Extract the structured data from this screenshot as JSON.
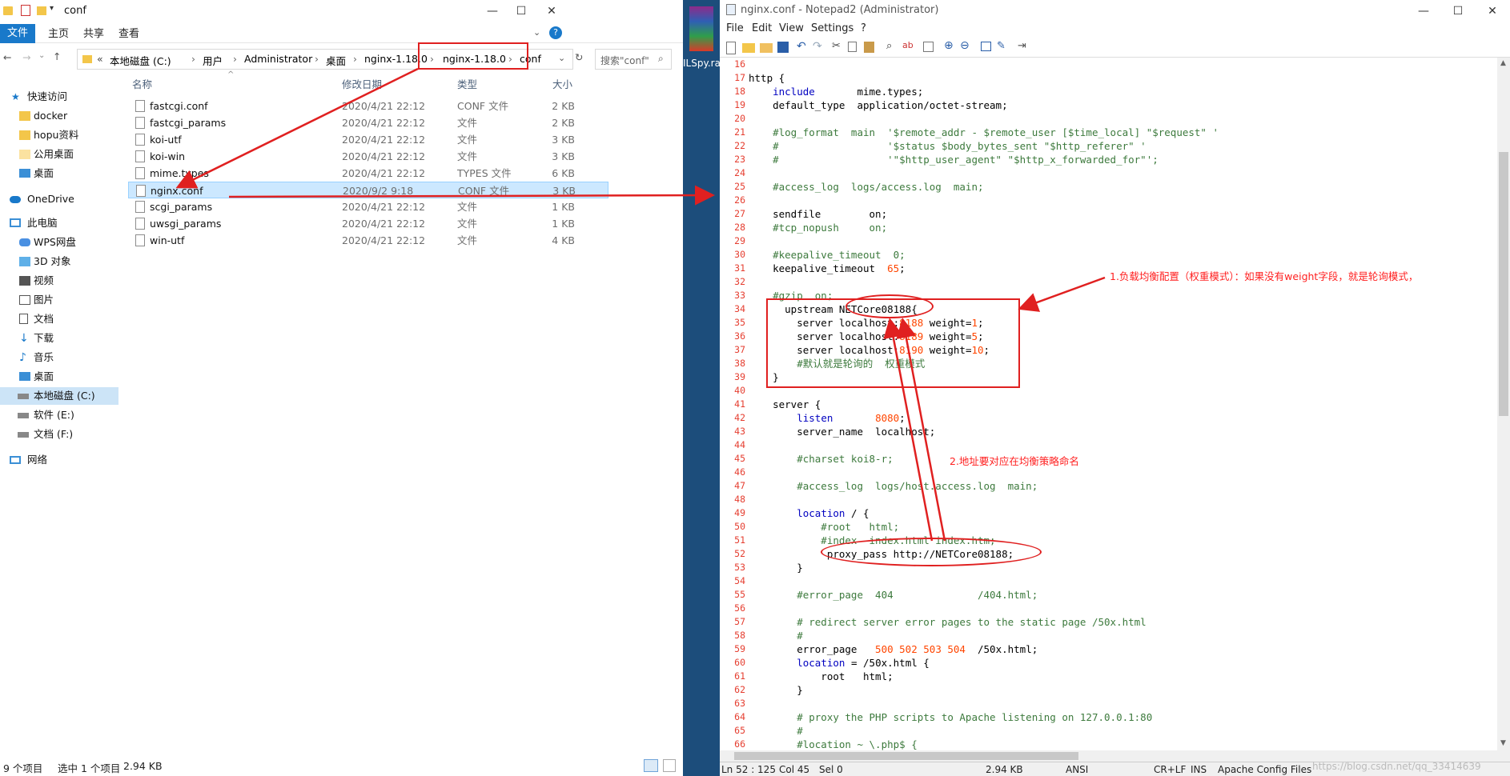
{
  "explorer": {
    "title": "conf",
    "ribbon_tabs": [
      "文件",
      "主页",
      "共享",
      "查看"
    ],
    "address": {
      "prefix": "«",
      "crumbs": [
        "本地磁盘 (C:)",
        "用户",
        "Administrator",
        "桌面",
        "nginx-1.18.0",
        "nginx-1.18.0",
        "conf"
      ]
    },
    "search_placeholder": "搜索\"conf\"",
    "nav": {
      "quick_access": "快速访问",
      "quick_items": [
        "docker",
        "hopu资料",
        "公用桌面",
        "桌面"
      ],
      "onedrive": "OneDrive",
      "this_pc": "此电脑",
      "pc_items": [
        "WPS网盘",
        "3D 对象",
        "视频",
        "图片",
        "文档",
        "下载",
        "音乐",
        "桌面",
        "本地磁盘 (C:)",
        "软件 (E:)",
        "文档 (F:)"
      ],
      "network": "网络"
    },
    "columns": {
      "name": "名称",
      "date": "修改日期",
      "type": "类型",
      "size": "大小"
    },
    "files": [
      {
        "name": "fastcgi.conf",
        "date": "2020/4/21 22:12",
        "type": "CONF 文件",
        "size": "2 KB"
      },
      {
        "name": "fastcgi_params",
        "date": "2020/4/21 22:12",
        "type": "文件",
        "size": "2 KB"
      },
      {
        "name": "koi-utf",
        "date": "2020/4/21 22:12",
        "type": "文件",
        "size": "3 KB"
      },
      {
        "name": "koi-win",
        "date": "2020/4/21 22:12",
        "type": "文件",
        "size": "3 KB"
      },
      {
        "name": "mime.types",
        "date": "2020/4/21 22:12",
        "type": "TYPES 文件",
        "size": "6 KB"
      },
      {
        "name": "nginx.conf",
        "date": "2020/9/2 9:18",
        "type": "CONF 文件",
        "size": "3 KB"
      },
      {
        "name": "scgi_params",
        "date": "2020/4/21 22:12",
        "type": "文件",
        "size": "1 KB"
      },
      {
        "name": "uwsgi_params",
        "date": "2020/4/21 22:12",
        "type": "文件",
        "size": "1 KB"
      },
      {
        "name": "win-utf",
        "date": "2020/4/21 22:12",
        "type": "文件",
        "size": "4 KB"
      }
    ],
    "status": {
      "count": "9 个项目",
      "selected": "选中 1 个项目",
      "size": "2.94 KB"
    }
  },
  "middle": {
    "label": "ILSpy.ra"
  },
  "notepad": {
    "title": "nginx.conf - Notepad2 (Administrator)",
    "menu": [
      "File",
      "Edit",
      "View",
      "Settings",
      "?"
    ],
    "lines": [
      {
        "n": "16",
        "t": ""
      },
      {
        "n": "17",
        "t": "http {"
      },
      {
        "n": "18",
        "t": "    include       mime.types;"
      },
      {
        "n": "19",
        "t": "    default_type  application/octet-stream;"
      },
      {
        "n": "20",
        "t": ""
      },
      {
        "n": "21",
        "t": "    #log_format  main  '$remote_addr - $remote_user [$time_local] \"$request\" '"
      },
      {
        "n": "22",
        "t": "    #                  '$status $body_bytes_sent \"$http_referer\" '"
      },
      {
        "n": "23",
        "t": "    #                  '\"$http_user_agent\" \"$http_x_forwarded_for\"';"
      },
      {
        "n": "24",
        "t": ""
      },
      {
        "n": "25",
        "t": "    #access_log  logs/access.log  main;"
      },
      {
        "n": "26",
        "t": ""
      },
      {
        "n": "27",
        "t": "    sendfile        on;"
      },
      {
        "n": "28",
        "t": "    #tcp_nopush     on;"
      },
      {
        "n": "29",
        "t": ""
      },
      {
        "n": "30",
        "t": "    #keepalive_timeout  0;"
      },
      {
        "n": "31",
        "t": "    keepalive_timeout  65;"
      },
      {
        "n": "32",
        "t": ""
      },
      {
        "n": "33",
        "t": "    #gzip  on;"
      },
      {
        "n": "34",
        "t": "      upstream NETCore08188{"
      },
      {
        "n": "35",
        "t": "        server localhost:8188 weight=1;"
      },
      {
        "n": "36",
        "t": "        server localhost:8189 weight=5;"
      },
      {
        "n": "37",
        "t": "        server localhost:8190 weight=10;"
      },
      {
        "n": "38",
        "t": "        #默认就是轮询的  权重模式"
      },
      {
        "n": "39",
        "t": "    }"
      },
      {
        "n": "40",
        "t": ""
      },
      {
        "n": "41",
        "t": "    server {"
      },
      {
        "n": "42",
        "t": "        listen       8080;"
      },
      {
        "n": "43",
        "t": "        server_name  localhost;"
      },
      {
        "n": "44",
        "t": ""
      },
      {
        "n": "45",
        "t": "        #charset koi8-r;"
      },
      {
        "n": "46",
        "t": ""
      },
      {
        "n": "47",
        "t": "        #access_log  logs/host.access.log  main;"
      },
      {
        "n": "48",
        "t": ""
      },
      {
        "n": "49",
        "t": "        location / {"
      },
      {
        "n": "50",
        "t": "            #root   html;"
      },
      {
        "n": "51",
        "t": "            #index  index.html index.htm;"
      },
      {
        "n": "52",
        "t": "             proxy_pass http://NETCore08188;"
      },
      {
        "n": "53",
        "t": "        }"
      },
      {
        "n": "54",
        "t": ""
      },
      {
        "n": "55",
        "t": "        #error_page  404              /404.html;"
      },
      {
        "n": "56",
        "t": ""
      },
      {
        "n": "57",
        "t": "        # redirect server error pages to the static page /50x.html"
      },
      {
        "n": "58",
        "t": "        #"
      },
      {
        "n": "59",
        "t": "        error_page   500 502 503 504  /50x.html;"
      },
      {
        "n": "60",
        "t": "        location = /50x.html {"
      },
      {
        "n": "61",
        "t": "            root   html;"
      },
      {
        "n": "62",
        "t": "        }"
      },
      {
        "n": "63",
        "t": ""
      },
      {
        "n": "64",
        "t": "        # proxy the PHP scripts to Apache listening on 127.0.0.1:80"
      },
      {
        "n": "65",
        "t": "        #"
      },
      {
        "n": "66",
        "t": "        #location ~ \\.php$ {"
      }
    ],
    "status": {
      "pos": "Ln 52 : 125",
      "col": "Col 45",
      "sel": "Sel 0",
      "size": "2.94 KB",
      "enc": "ANSI",
      "eol": "CR+LF",
      "ins": "INS",
      "mode": "Apache Config Files"
    }
  },
  "annotations": {
    "note1": "1.负载均衡配置（权重模式）：如果没有weight字段，就是轮询模式，",
    "note2": "2.地址要对应在均衡策略命名"
  },
  "watermark": "https://blog.csdn.net/qq_33414639",
  "colors": {
    "annotation": "#e02020",
    "ribbon_file": "#1979ca",
    "line_numbers": "#e53e30"
  }
}
